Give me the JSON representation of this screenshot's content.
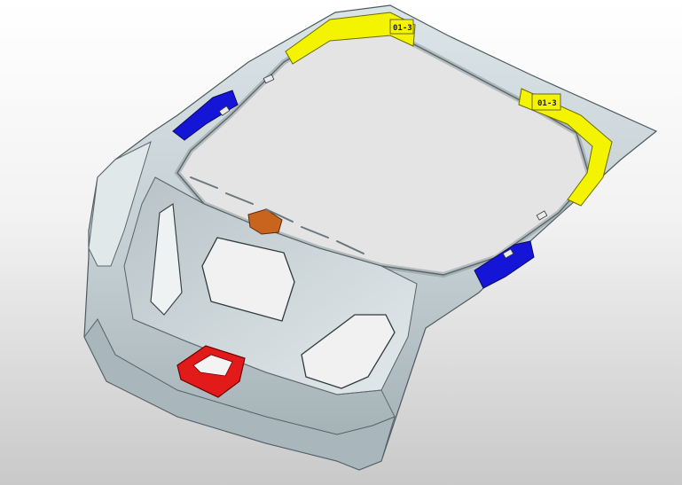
{
  "viewport": {
    "name": "cad-3d-viewport",
    "background_top": "#ffffff",
    "background_bottom": "#c9c9c9"
  },
  "model": {
    "part": "tailgate-inner-panel",
    "body_color": "#c7d2d6",
    "edge_color": "#4f5a5e",
    "shadow_color": "#8d9a9f"
  },
  "zones": [
    {
      "name": "upper-seal-zone",
      "color": "#f4f400",
      "tag": "01-3"
    },
    {
      "name": "right-seal-zone",
      "color": "#f4f400",
      "tag": "01-3"
    },
    {
      "name": "left-hinge-zone",
      "color": "#1515d8",
      "tag": ""
    },
    {
      "name": "lower-right-zone",
      "color": "#1515d8",
      "tag": ""
    },
    {
      "name": "latch-reinforcement-zone",
      "color": "#e31a1a",
      "tag": ""
    },
    {
      "name": "center-bracket-zone",
      "color": "#c8641e",
      "tag": ""
    }
  ]
}
